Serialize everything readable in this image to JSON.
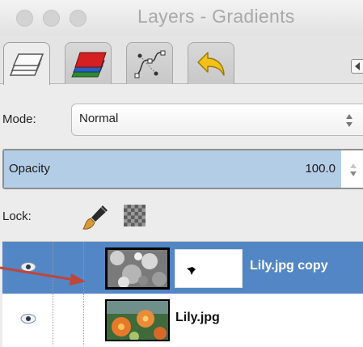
{
  "window": {
    "title": "Layers - Gradients"
  },
  "tabs": [
    {
      "icon": "layers-icon",
      "active": true
    },
    {
      "icon": "channels-icon",
      "active": false
    },
    {
      "icon": "paths-icon",
      "active": false
    },
    {
      "icon": "undo-history-icon",
      "active": false
    }
  ],
  "mode": {
    "label": "Mode:",
    "value": "Normal"
  },
  "opacity": {
    "label": "Opacity",
    "value": "100.0",
    "percent": 100
  },
  "lock": {
    "label": "Lock:",
    "items": [
      "lock-pixels-brush-icon",
      "lock-alpha-checker-icon"
    ]
  },
  "layers": [
    {
      "name": "Lily.jpg copy",
      "selected": true,
      "has_mask": true,
      "visible": true
    },
    {
      "name": "Lily.jpg",
      "selected": false,
      "has_mask": false,
      "visible": true
    }
  ],
  "colors": {
    "selection": "#5386c5",
    "opacity_fill": "#b4cde6",
    "annotation_arrow": "#c0453a"
  }
}
